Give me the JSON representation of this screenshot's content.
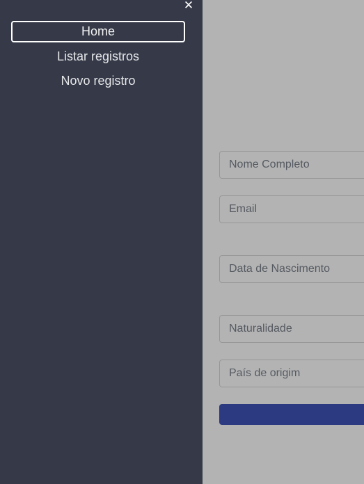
{
  "sidebar": {
    "close_glyph": "✕",
    "items": [
      {
        "label": "Home",
        "active": true
      },
      {
        "label": "Listar registros",
        "active": false
      },
      {
        "label": "Novo registro",
        "active": false
      }
    ],
    "background_color": "#363a48"
  },
  "form": {
    "fields": [
      {
        "placeholder": "Nome Completo",
        "value": ""
      },
      {
        "placeholder": "Email",
        "value": ""
      },
      {
        "placeholder": "Data de Nascimento",
        "value": ""
      },
      {
        "placeholder": "Naturalidade",
        "value": ""
      },
      {
        "placeholder": "País de origim",
        "value": ""
      }
    ],
    "submit_label": "",
    "submit_color": "#2c3a82"
  },
  "overlay_color": "#b3b3b3"
}
